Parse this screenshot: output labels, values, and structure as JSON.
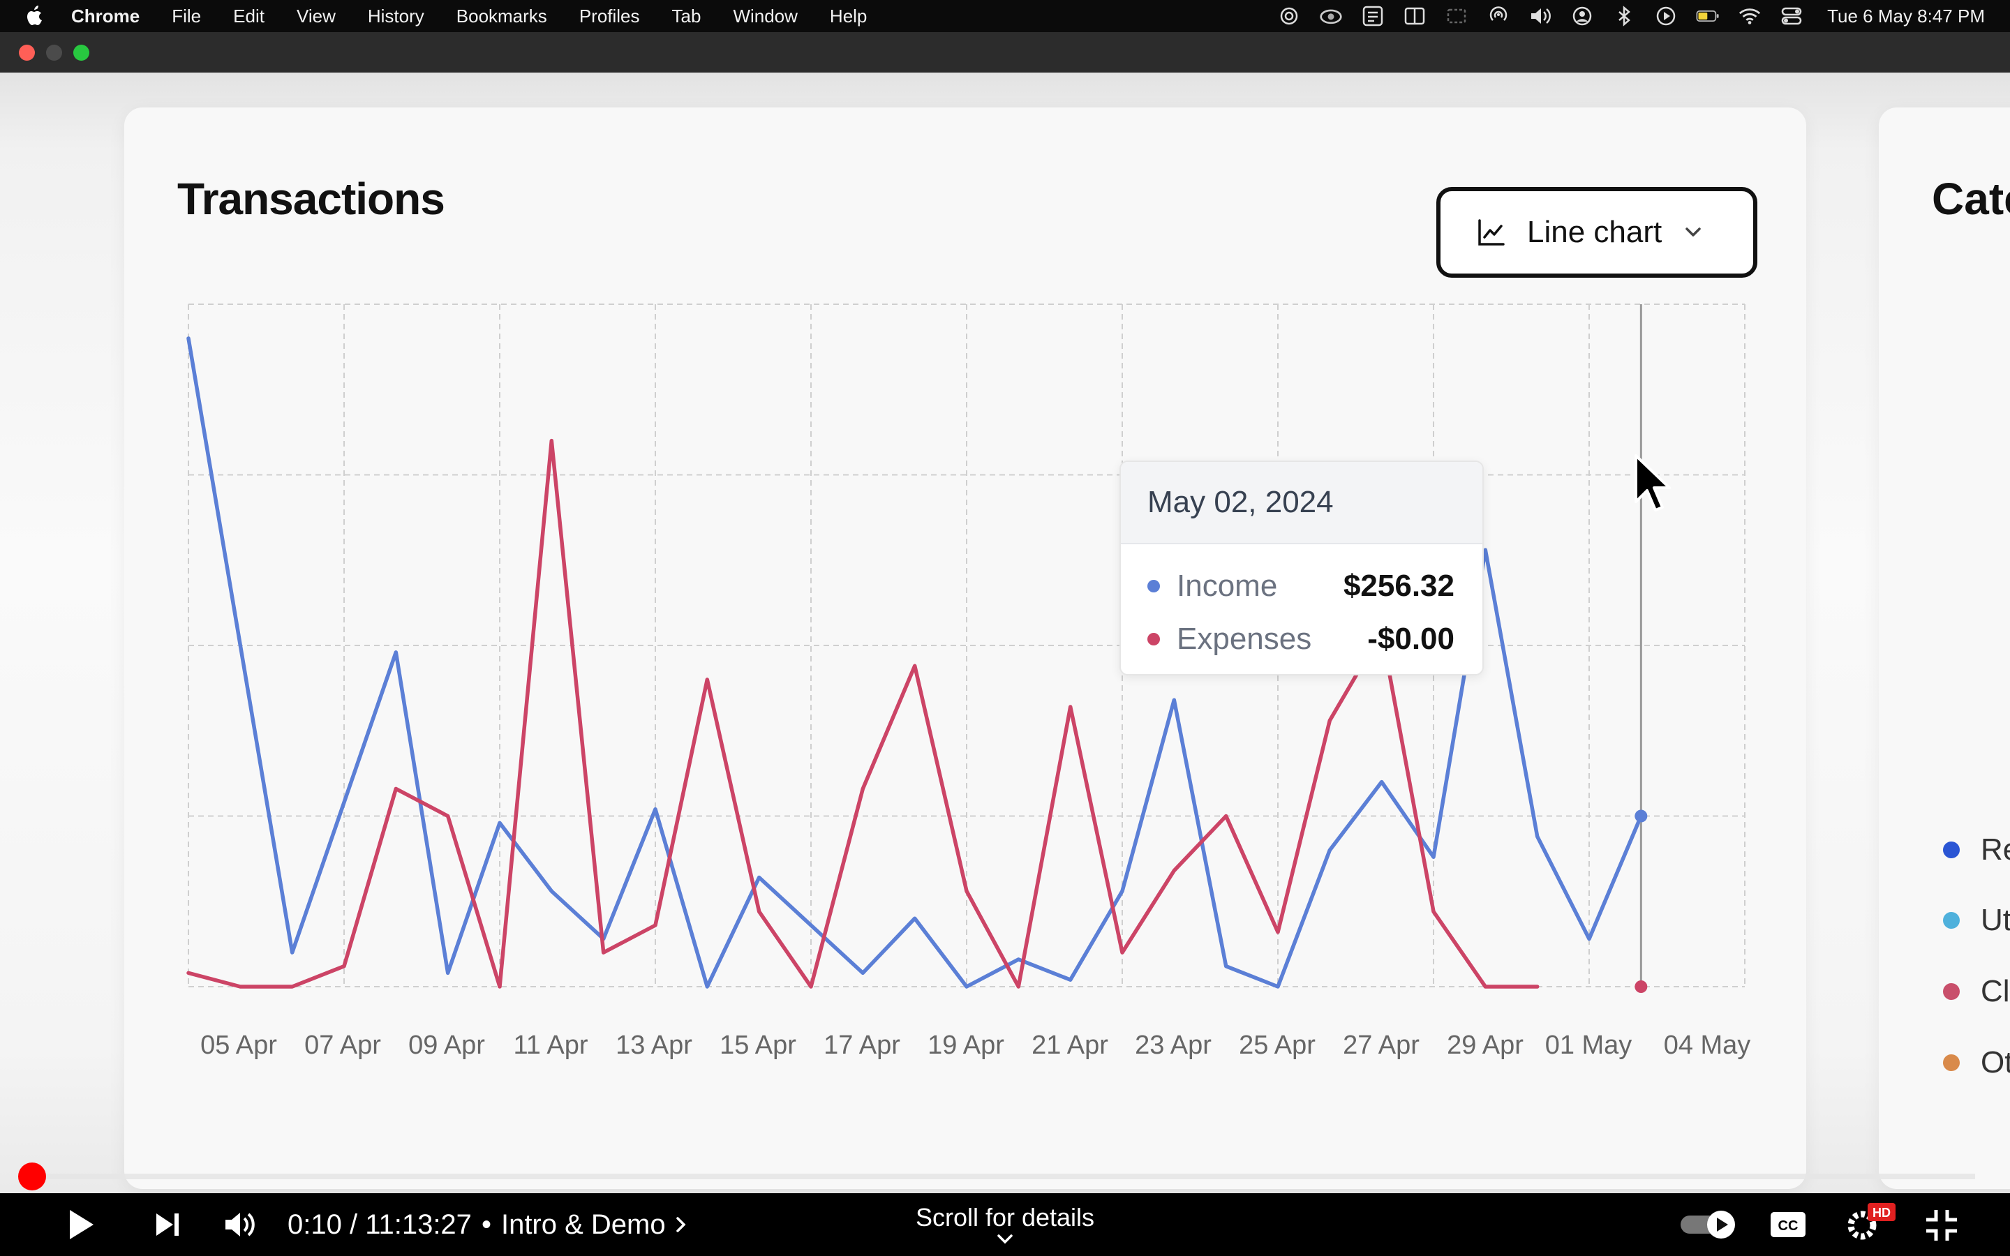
{
  "menubar": {
    "apple_icon": "apple-logo-icon",
    "app_name": "Chrome",
    "items": [
      "File",
      "Edit",
      "View",
      "History",
      "Bookmarks",
      "Profiles",
      "Tab",
      "Window",
      "Help"
    ],
    "datetime": "Tue 6 May  8:47 PM",
    "status_icons": [
      "openai-icon",
      "creative-cloud-icon",
      "text-scan-icon",
      "split-view-icon",
      "screen-mirror-icon",
      "airdrop-icon",
      "volume-icon",
      "user-account-icon",
      "bluetooth-icon",
      "play-circle-icon",
      "battery-icon",
      "wifi-icon",
      "control-center-icon"
    ]
  },
  "window": {
    "traffic_lights": [
      "close",
      "minimize",
      "zoom"
    ],
    "colors": {
      "close": "#ff5f57",
      "minimize": "#4b4b4b",
      "zoom": "#28c840"
    }
  },
  "card": {
    "title": "Transactions",
    "chart_select_label": "Line chart"
  },
  "card2": {
    "title_partial": "Cate",
    "legend": [
      {
        "label": "Re",
        "color": "#2a55d4"
      },
      {
        "label": "Ut",
        "color": "#4fb1dc"
      },
      {
        "label": "Cl",
        "color": "#c94f6b"
      },
      {
        "label": "Ot",
        "color": "#d98a4a"
      }
    ]
  },
  "tooltip": {
    "date": "May 02, 2024",
    "rows": [
      {
        "label": "Income",
        "value": "$256.32",
        "color": "#5b7fd6"
      },
      {
        "label": "Expenses",
        "value": "-$0.00",
        "color": "#cc4466"
      }
    ]
  },
  "chart_data": {
    "type": "line",
    "x_tick_labels": [
      "05 Apr",
      "07 Apr",
      "09 Apr",
      "11 Apr",
      "13 Apr",
      "15 Apr",
      "17 Apr",
      "19 Apr",
      "21 Apr",
      "23 Apr",
      "25 Apr",
      "27 Apr",
      "29 Apr",
      "01 May",
      "04 May"
    ],
    "grid": true,
    "y_axis_visible": false,
    "ylim": [
      0,
      100
    ],
    "series": [
      {
        "name": "Income",
        "color": "#5b7fd6",
        "points": [
          [
            0,
            95
          ],
          [
            2,
            5
          ],
          [
            4,
            49
          ],
          [
            5,
            2
          ],
          [
            6,
            24
          ],
          [
            7,
            14
          ],
          [
            8,
            7
          ],
          [
            9,
            26
          ],
          [
            10,
            0
          ],
          [
            11,
            16
          ],
          [
            12,
            9
          ],
          [
            13,
            2
          ],
          [
            14,
            10
          ],
          [
            15,
            0
          ],
          [
            16,
            4
          ],
          [
            17,
            1
          ],
          [
            18,
            14
          ],
          [
            19,
            42
          ],
          [
            20,
            3
          ],
          [
            21,
            0
          ],
          [
            22,
            20
          ],
          [
            23,
            30
          ],
          [
            24,
            19
          ],
          [
            25,
            64
          ],
          [
            26,
            22
          ],
          [
            27,
            7
          ],
          [
            28,
            25
          ]
        ]
      },
      {
        "name": "Expenses",
        "color": "#cc4466",
        "points": [
          [
            0,
            2
          ],
          [
            1,
            0
          ],
          [
            2,
            0
          ],
          [
            3,
            3
          ],
          [
            4,
            29
          ],
          [
            5,
            25
          ],
          [
            6,
            0
          ],
          [
            7,
            80
          ],
          [
            8,
            5
          ],
          [
            9,
            9
          ],
          [
            10,
            45
          ],
          [
            11,
            11
          ],
          [
            12,
            0
          ],
          [
            13,
            29
          ],
          [
            14,
            47
          ],
          [
            15,
            14
          ],
          [
            16,
            0
          ],
          [
            17,
            41
          ],
          [
            18,
            5
          ],
          [
            19,
            17
          ],
          [
            20,
            25
          ],
          [
            21,
            8
          ],
          [
            22,
            39
          ],
          [
            23,
            52
          ],
          [
            24,
            11
          ],
          [
            25,
            0
          ],
          [
            26,
            0
          ]
        ]
      }
    ],
    "highlight_index": 28
  },
  "player": {
    "time": "0:10 / 11:13:27",
    "chapter": "Intro & Demo",
    "scroll_hint": "Scroll for details",
    "progress_fraction": 0.0003,
    "colors": {
      "progress": "#ff0000"
    },
    "icons": [
      "play-icon",
      "next-icon",
      "volume-icon",
      "chapter-chevron-icon",
      "scroll-down-chevron-icon",
      "autoplay-toggle-icon",
      "captions-icon",
      "settings-icon",
      "hd-badge",
      "exit-fullscreen-icon"
    ]
  }
}
